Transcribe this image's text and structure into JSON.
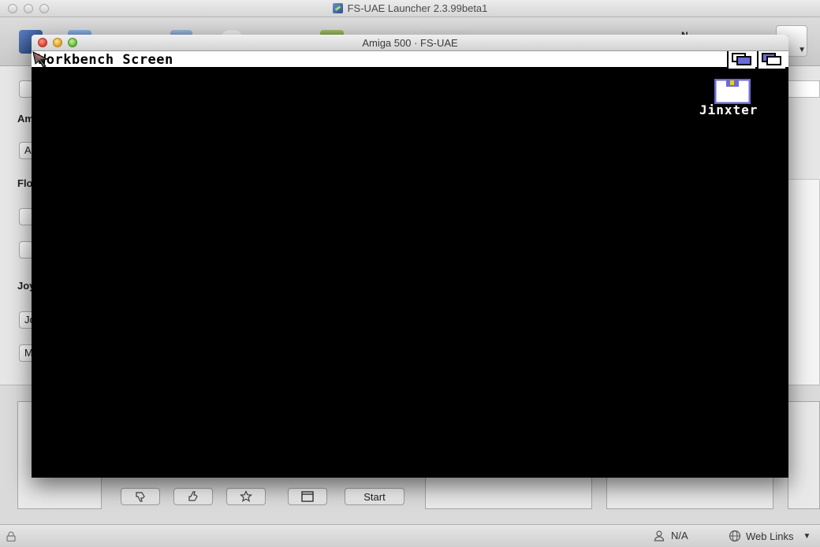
{
  "launcher": {
    "window_title": "FS-UAE Launcher 2.3.99beta1",
    "toolbar_right_text": "N",
    "sidebar": [
      {
        "label": "Am",
        "control": "A"
      },
      {
        "label": "Flo",
        "control": ""
      },
      {
        "label": "Joy",
        "control": "Jo"
      },
      {
        "extra_control": "M"
      }
    ],
    "buttons": {
      "start": "Start"
    },
    "status": {
      "network": "N/A",
      "web_links": "Web Links"
    }
  },
  "emulator": {
    "window_title": "Amiga 500 · FS-UAE",
    "screen_title": "Workbench Screen",
    "disk_label": "Jinxter",
    "colors": {
      "screen_bg": "#000000",
      "title_bar": "#ffffff",
      "depth_gadget_fill": "#6b6bd6",
      "disk_accent": "#f0d000"
    }
  }
}
